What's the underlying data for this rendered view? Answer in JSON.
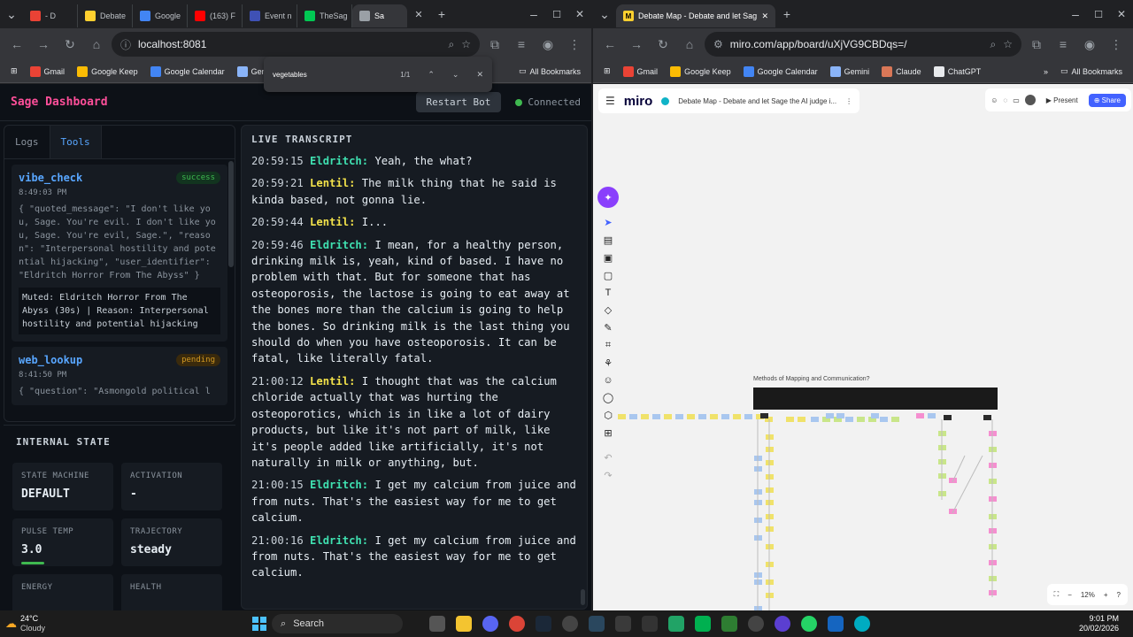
{
  "left_browser": {
    "tabs": [
      {
        "label": "- D",
        "color": "#e94235"
      },
      {
        "label": "Debate",
        "color": "#ffd02f"
      },
      {
        "label": "Google",
        "color": "#4285f4"
      },
      {
        "label": "(163) F",
        "color": "#ff0000"
      },
      {
        "label": "Event n",
        "color": "#3f51b5"
      },
      {
        "label": "TheSag",
        "color": "#00c853"
      },
      {
        "label": "Sa",
        "color": "#9aa0a6"
      }
    ],
    "url": "localhost:8081",
    "bookmarks": [
      "Gmail",
      "Google Keep",
      "Google Calendar",
      "Gem"
    ],
    "all_bookmarks": "All Bookmarks",
    "find": {
      "query": "vegetables",
      "count": "1/1"
    }
  },
  "sage": {
    "title": "Sage Dashboard",
    "restart": "Restart Bot",
    "status": "Connected",
    "tab_logs": "Logs",
    "tab_tools": "Tools",
    "tools": [
      {
        "name": "vibe_check",
        "status": "success",
        "time": "8:49:03 PM",
        "json": "{ \"quoted_message\": \"I don't like you, Sage. You're evil. I don't like you, Sage. You're evil, Sage.\", \"reason\": \"Interpersonal hostility and potential hijacking\", \"user_identifier\": \"Eldritch Horror From The Abyss\" }",
        "result": "Muted: Eldritch Horror From The Abyss (30s) | Reason: Interpersonal hostility and potential hijacking"
      },
      {
        "name": "web_lookup",
        "status": "pending",
        "time": "8:41:50 PM",
        "json": "{ \"question\": \"Asmongold political l"
      }
    ],
    "internal_title": "INTERNAL STATE",
    "state": [
      {
        "label": "STATE MACHINE",
        "value": "DEFAULT"
      },
      {
        "label": "ACTIVATION",
        "value": "-"
      },
      {
        "label": "PULSE TEMP",
        "value": "3.0"
      },
      {
        "label": "TRAJECTORY",
        "value": "steady"
      },
      {
        "label": "ENERGY",
        "value": ""
      },
      {
        "label": "HEALTH",
        "value": ""
      }
    ],
    "transcript_title": "LIVE TRANSCRIPT",
    "transcript": [
      {
        "time": "20:59:15",
        "speaker": "Eldritch:",
        "text": "Yeah, the what?",
        "color": "#3fe0b0"
      },
      {
        "time": "20:59:21",
        "speaker": "Lentil:",
        "text": "The milk thing that he said is kinda based, not gonna lie.",
        "color": "#f2e14a"
      },
      {
        "time": "20:59:44",
        "speaker": "Lentil:",
        "text": "I...",
        "color": "#f2e14a"
      },
      {
        "time": "20:59:46",
        "speaker": "Eldritch:",
        "text": "I mean, for a healthy person, drinking milk is, yeah, kind of based. I have no problem with that. But for someone that has osteoporosis, the lactose is going to eat away at the bones more than the calcium is going to help the bones. So drinking milk is the last thing you should do when you have osteoporosis. It can be fatal, like literally fatal.",
        "color": "#3fe0b0"
      },
      {
        "time": "21:00:12",
        "speaker": "Lentil:",
        "text": "I thought that was the calcium chloride actually that was hurting the osteoporotics, which is in like a lot of dairy products, but like it's not part of milk, like it's people added like artificially, it's not naturally in milk or anything, but.",
        "color": "#f2e14a"
      },
      {
        "time": "21:00:15",
        "speaker": "Eldritch:",
        "text": "I get my calcium from juice and from nuts. That's the easiest way for me to get calcium.",
        "color": "#3fe0b0"
      },
      {
        "time": "21:00:16",
        "speaker": "Eldritch:",
        "text": "I get my calcium from juice and from nuts. That's the easiest way for me to get calcium.",
        "color": "#3fe0b0"
      }
    ]
  },
  "right_browser": {
    "tab": "Debate Map - Debate and let Sage th",
    "url": "miro.com/app/board/uXjVG9CBDqs=/",
    "bookmarks": [
      "Gmail",
      "Google Keep",
      "Google Calendar",
      "Gemini",
      "Claude",
      "ChatGPT"
    ],
    "all_bookmarks": "All Bookmarks"
  },
  "miro": {
    "logo": "miro",
    "board_title": "Debate Map - Debate and let Sage the AI judge i...",
    "present": "Present",
    "share": "Share",
    "frame_title": "Methods of Mapping and Communication?",
    "zoom": "12%"
  },
  "taskbar": {
    "temp": "24°C",
    "weather": "Cloudy",
    "search": "Search",
    "time": "9:01 PM",
    "date": "20/02/2026"
  }
}
